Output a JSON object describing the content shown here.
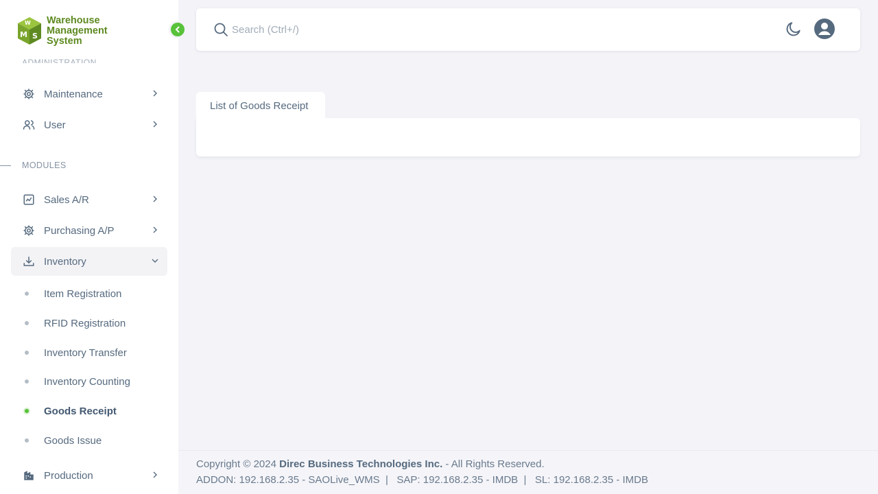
{
  "brand": {
    "line1": "Warehouse",
    "line2": "Management",
    "line3": "System",
    "color": "#5e8a21"
  },
  "sidebar": {
    "clipped_section": "ADMINISTRATION",
    "admin_items": [
      {
        "label": "Maintenance",
        "icon": "gear-icon"
      },
      {
        "label": "User",
        "icon": "users-icon"
      }
    ],
    "modules_header": "MODULES",
    "module_items": [
      {
        "label": "Sales A/R",
        "icon": "chart-icon"
      },
      {
        "label": "Purchasing A/P",
        "icon": "gear-icon"
      },
      {
        "label": "Inventory",
        "icon": "download-icon",
        "expanded": true
      }
    ],
    "inventory_sub": [
      {
        "label": "Item Registration"
      },
      {
        "label": "RFID Registration"
      },
      {
        "label": "Inventory Transfer"
      },
      {
        "label": "Inventory Counting"
      },
      {
        "label": "Goods Receipt",
        "active": true
      },
      {
        "label": "Goods Issue"
      }
    ],
    "production": {
      "label": "Production",
      "icon": "building-icon"
    }
  },
  "navbar": {
    "search_placeholder": "Search (Ctrl+/)",
    "search_value": ""
  },
  "main": {
    "tab_label": "List of Goods Receipt"
  },
  "footer": {
    "copyright_prefix": "Copyright © 2024",
    "company": "Direc Business Technologies Inc.",
    "rights": "- All Rights Reserved.",
    "addon": "ADDON: 192.168.2.35 - SAOLive_WMS",
    "sap": "SAP: 192.168.2.35 - IMDB",
    "sl": "SL: 192.168.2.35 - IMDB",
    "separator": "|"
  },
  "colors": {
    "accent": "#58c23a",
    "sidebar_bg": "#ffffff",
    "page_bg": "#f3f3f8",
    "text": "#566a7f"
  }
}
